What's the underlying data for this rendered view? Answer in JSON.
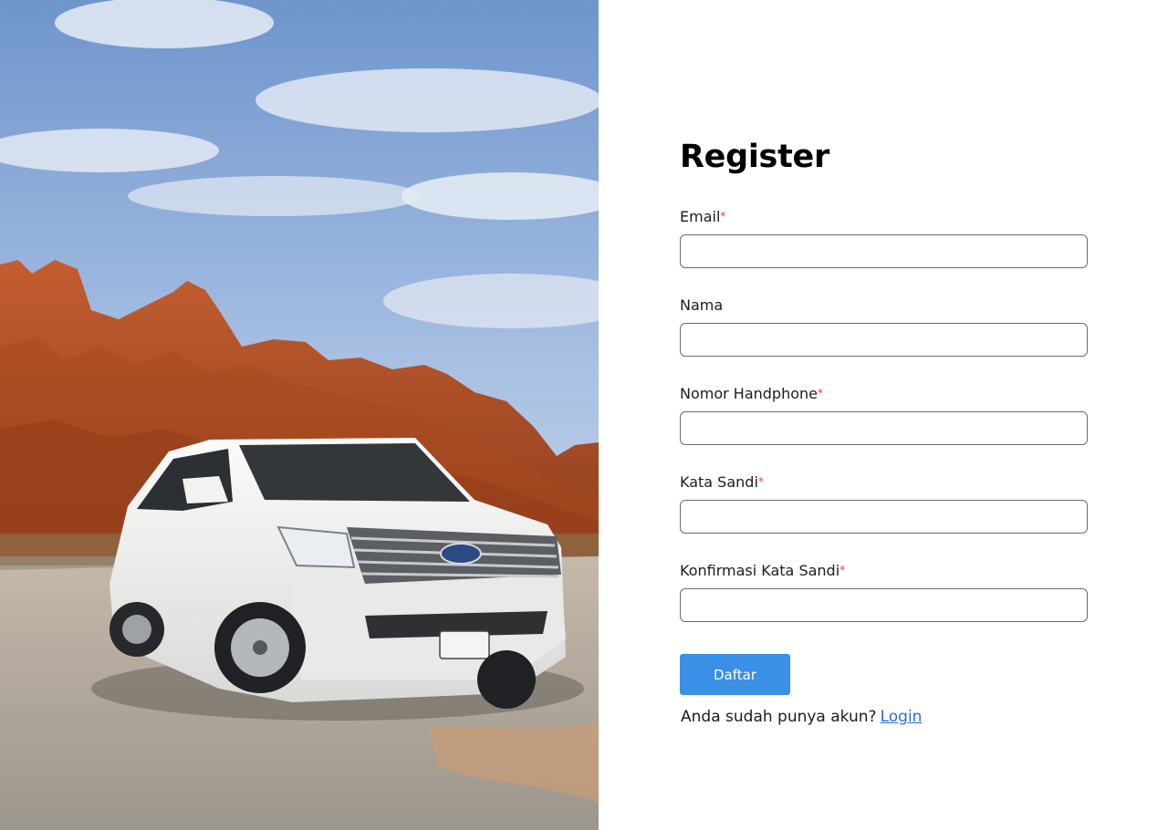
{
  "hero": {
    "image_subject": "white SUV parked on gravel in front of red rock formations under a cloudy blue sky",
    "colors": {
      "sky": "#7fa3d6",
      "rock": "#b9532a",
      "car": "#f1f1f0",
      "ground": "#b8b1a6"
    }
  },
  "form": {
    "title": "Register",
    "required_mark": "*",
    "fields": [
      {
        "label": "Email",
        "required": true,
        "value": "",
        "placeholder": ""
      },
      {
        "label": "Nama",
        "required": false,
        "value": "",
        "placeholder": ""
      },
      {
        "label": "Nomor Handphone",
        "required": true,
        "value": "",
        "placeholder": ""
      },
      {
        "label": "Kata Sandi",
        "required": true,
        "value": "",
        "placeholder": ""
      },
      {
        "label": "Konfirmasi Kata Sandi",
        "required": true,
        "value": "",
        "placeholder": ""
      }
    ],
    "submit_label": "Daftar",
    "login_prompt": "Anda sudah punya akun?",
    "login_link": "Login"
  },
  "colors": {
    "button": "#3a8fe6",
    "required": "#e53935",
    "link": "#2e6fd0"
  }
}
